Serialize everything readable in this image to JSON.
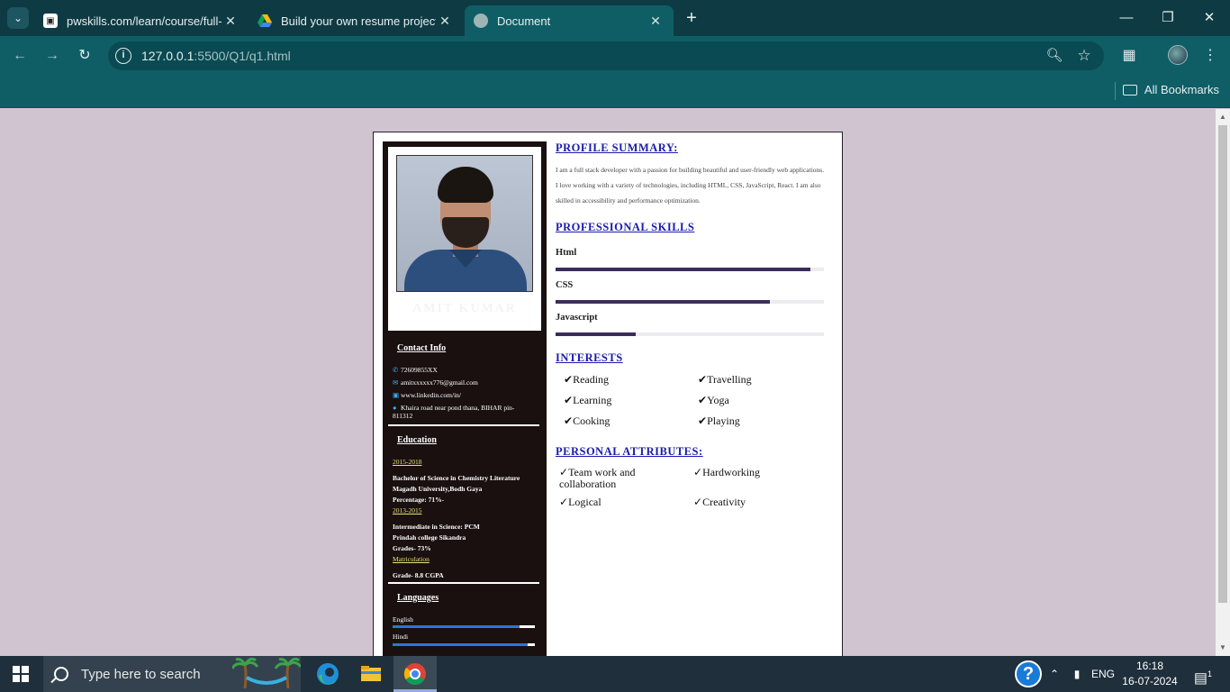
{
  "browser": {
    "tabs": [
      {
        "title": "pwskills.com/learn/course/full-s",
        "active": false
      },
      {
        "title": "Build your own resume project.",
        "active": false
      },
      {
        "title": "Document",
        "active": true
      }
    ],
    "url_host": "127.0.0.1",
    "url_path": ":5500/Q1/q1.html",
    "bookmarks_label": "All Bookmarks"
  },
  "resume": {
    "name": "AMIT KUMAR",
    "contact": {
      "title": "Contact Info",
      "phone": "72609855XX",
      "email": "amitxxxxxx776@gmail.com",
      "linkedin": "www.linkedin.com/in/",
      "address_line1": "Khaira road near pond thana, BIHAR pin-",
      "address_line2": "811312"
    },
    "education": {
      "title": "Education",
      "entries": [
        {
          "years": "2015-2018",
          "lines": [
            "Bachelor of Science in Chemistry Literature",
            "Magadh University,Bodh Gaya",
            "Percentage: 71%-"
          ]
        },
        {
          "years": "2013-2015",
          "lines": [
            "Intermediate in Science: PCM",
            "Prindah college Sikandra",
            "Grades- 73%"
          ]
        },
        {
          "years": "Matriculation",
          "lines": [
            "Grade- 8.8 CGPA"
          ]
        }
      ]
    },
    "languages": {
      "title": "Languages",
      "items": [
        {
          "name": "English",
          "level": 0.89
        },
        {
          "name": "Hindi",
          "level": 0.95
        }
      ]
    },
    "summary": {
      "title": "PROFILE SUMMARY:",
      "text": "I am a full stack developer with a passion for building beautiful and user-friendly web applications. I love working with a variety of technologies, including HTML, CSS, JavaScript, React. I am also skilled in accessibility and performance optimization."
    },
    "skills": {
      "title": "PROFESSIONAL SKILLS",
      "items": [
        {
          "name": "Html",
          "level": 0.95
        },
        {
          "name": "CSS",
          "level": 0.8
        },
        {
          "name": "Javascript",
          "level": 0.3
        }
      ]
    },
    "interests": {
      "title": "INTERESTS",
      "items": [
        "Reading",
        "Travelling",
        "Learning",
        "Yoga",
        "Cooking",
        "Playing"
      ]
    },
    "attributes": {
      "title": "PERSONAL ATTRIBUTES:",
      "items": [
        "Team work and collaboration",
        "Hardworking",
        "Logical",
        "Creativity"
      ]
    }
  },
  "taskbar": {
    "search_placeholder": "Type here to search",
    "language": "ENG",
    "time": "16:18",
    "date": "16-07-2024",
    "notification_count": "1"
  },
  "colors": {
    "chrome_dark": "#0e3b43",
    "chrome": "#0f5e66",
    "page_bg": "#d1c4d1",
    "sidebar_bg": "#1a1010",
    "heading_blue": "#1a1ab0",
    "skill_fill": "#3b2d5a",
    "lang_fill": "#2f74d8"
  }
}
